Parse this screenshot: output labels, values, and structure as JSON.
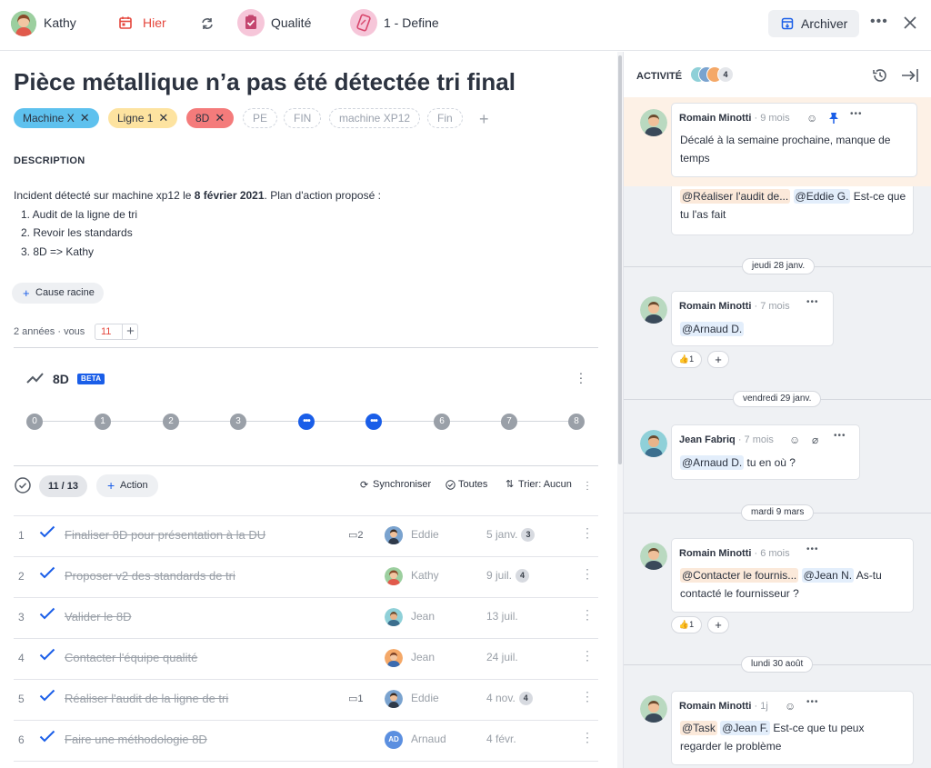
{
  "topbar": {
    "user": "Kathy",
    "date_label": "Hier",
    "status_label": "Qualité",
    "phase_label": "1 - Define",
    "archive_label": "Archiver"
  },
  "issue": {
    "title": "Pièce métallique n’a pas été détectée tri final",
    "tags": [
      {
        "label": "Machine X",
        "color": "#5ec1ee"
      },
      {
        "label": "Ligne 1",
        "color": "#fde3a0"
      },
      {
        "label": "8D",
        "color": "#f47b7b"
      }
    ],
    "suggested_tags": [
      "PE",
      "FIN",
      "machine XP12",
      "Fin"
    ],
    "description_heading": "DESCRIPTION",
    "description_intro_before": "Incident détecté sur machine xp12 le ",
    "description_intro_bold": "8 février 2021",
    "description_intro_after": ". Plan d'action proposé :",
    "description_list": [
      "1. Audit de la ligne de tri",
      "2. Revoir les standards",
      "3. 8D => Kathy"
    ],
    "root_cause_label": "Cause racine",
    "meta_age": "2 années",
    "meta_sep": "·",
    "meta_user": "vous",
    "meta_count": "11"
  },
  "eightd": {
    "title": "8D",
    "badge": "BETA",
    "steps": [
      "0",
      "1",
      "2",
      "3",
      "•••",
      "•••",
      "6",
      "7",
      "8"
    ]
  },
  "actions": {
    "progress": "11 / 13",
    "add_label": "Action",
    "sync_label": "Synchroniser",
    "filter_label": "Toutes",
    "sort_label": "Trier: Aucun",
    "rows": [
      {
        "num": "1",
        "title": "Finaliser 8D pour présentation à la DU",
        "comments": "2",
        "assignee": "Eddie",
        "date": "5 janv.",
        "badge": "3"
      },
      {
        "num": "2",
        "title": "Proposer v2 des standards de tri",
        "comments": "",
        "assignee": "Kathy",
        "date": "9 juil.",
        "badge": "4"
      },
      {
        "num": "3",
        "title": "Valider le 8D",
        "comments": "",
        "assignee": "Jean",
        "date": "13 juil.",
        "badge": ""
      },
      {
        "num": "4",
        "title": "Contacter l'équipe qualité",
        "comments": "",
        "assignee": "Jean",
        "date": "24 juil.",
        "badge": ""
      },
      {
        "num": "5",
        "title": "Réaliser l'audit de la ligne de tri",
        "comments": "1",
        "assignee": "Eddie",
        "date": "4 nov.",
        "badge": "4"
      },
      {
        "num": "6",
        "title": "Faire une méthodologie 8D",
        "comments": "",
        "assignee": "Arnaud",
        "date": "4 févr.",
        "badge": "",
        "initials": "AD"
      }
    ]
  },
  "activity": {
    "title": "ACTIVITÉ",
    "participants_count": "4",
    "pinned": {
      "author": "Romain Minotti",
      "time": "· 9 mois",
      "text": "Décalé à la semaine prochaine, manque de temps"
    },
    "prev_card": {
      "mention1": "@Réaliser l'audit de...",
      "mention2": "@Eddie G.",
      "text": " Est-ce que tu l'as fait"
    },
    "date1": "jeudi 28 janv.",
    "msg1": {
      "author": "Romain Minotti",
      "time": "· 7 mois",
      "mention": "@Arnaud D.",
      "reaction_count": "1"
    },
    "date2": "vendredi 29 janv.",
    "msg2": {
      "author": "Jean Fabriq",
      "time": "· 7 mois",
      "mention": "@Arnaud D.",
      "text": " tu en où ?"
    },
    "date3": "mardi 9 mars",
    "msg3": {
      "author": "Romain Minotti",
      "time": "· 6 mois",
      "mention1": "@Contacter le fournis...",
      "mention2": "@Jean N.",
      "text1": " As-tu",
      "text2": "contacté le fournisseur ?",
      "reaction_count": "1"
    },
    "date4": "lundi 30 août",
    "msg4": {
      "author": "Romain Minotti",
      "time": "· 1j",
      "mention1": "@Task",
      "mention2": "@Jean F.",
      "text1": " Est-ce que tu peux",
      "text2": "regarder le problème"
    }
  },
  "colors": {
    "accent": "#1a5ee8",
    "danger": "#e5473d",
    "pinned_bg": "#fdf1e6"
  }
}
